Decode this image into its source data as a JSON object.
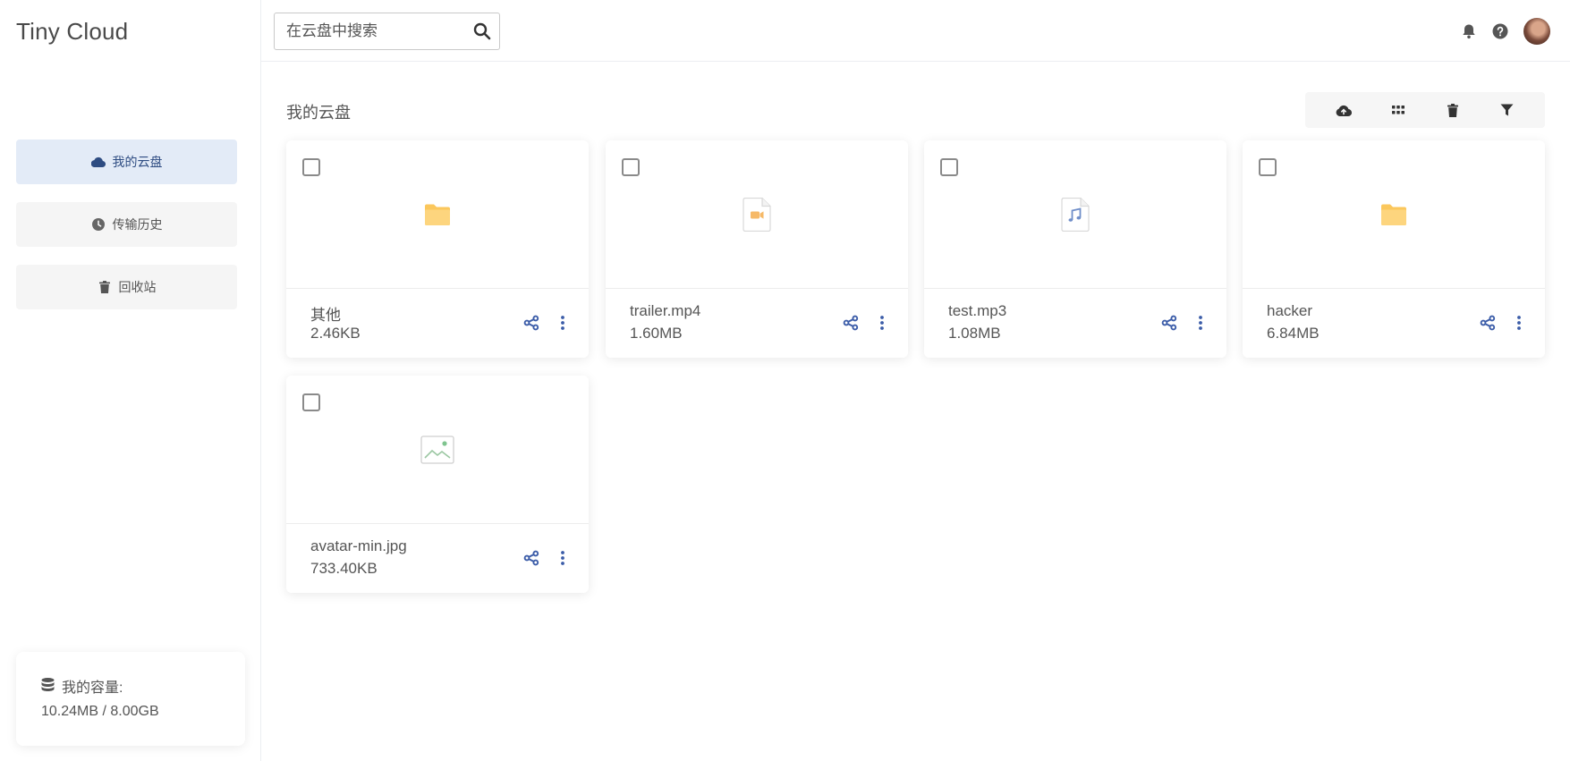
{
  "app": {
    "brand": "Tiny Cloud"
  },
  "sidebar": {
    "items": [
      {
        "label": "我的云盘",
        "icon": "cloud-icon",
        "active": true
      },
      {
        "label": "传输历史",
        "icon": "clock-icon",
        "active": false
      },
      {
        "label": "回收站",
        "icon": "trash-icon",
        "active": false
      }
    ],
    "capacity": {
      "label": "我的容量:",
      "value": "10.24MB / 8.00GB",
      "icon": "database-icon"
    }
  },
  "header": {
    "search": {
      "placeholder": "在云盘中搜索",
      "value": ""
    },
    "icons": [
      "bell-icon",
      "help-icon",
      "avatar"
    ]
  },
  "main": {
    "title": "我的云盘",
    "toolbar": [
      "cloud-upload-icon",
      "grid-view-icon",
      "trash-icon",
      "filter-icon"
    ],
    "files": [
      {
        "name": "其他",
        "size": "2.46KB",
        "type": "folder"
      },
      {
        "name": "trailer.mp4",
        "size": "1.60MB",
        "type": "video"
      },
      {
        "name": "test.mp3",
        "size": "1.08MB",
        "type": "audio"
      },
      {
        "name": "hacker",
        "size": "6.84MB",
        "type": "folder"
      },
      {
        "name": "avatar-min.jpg",
        "size": "733.40KB",
        "type": "image"
      }
    ]
  },
  "colors": {
    "accent": "#3b5ca8",
    "folder": "#fbc75c",
    "video": "#f6b967",
    "audio": "#6f8ec9",
    "image": "#7fc48f",
    "active_nav_bg": "#e3ebf7"
  }
}
